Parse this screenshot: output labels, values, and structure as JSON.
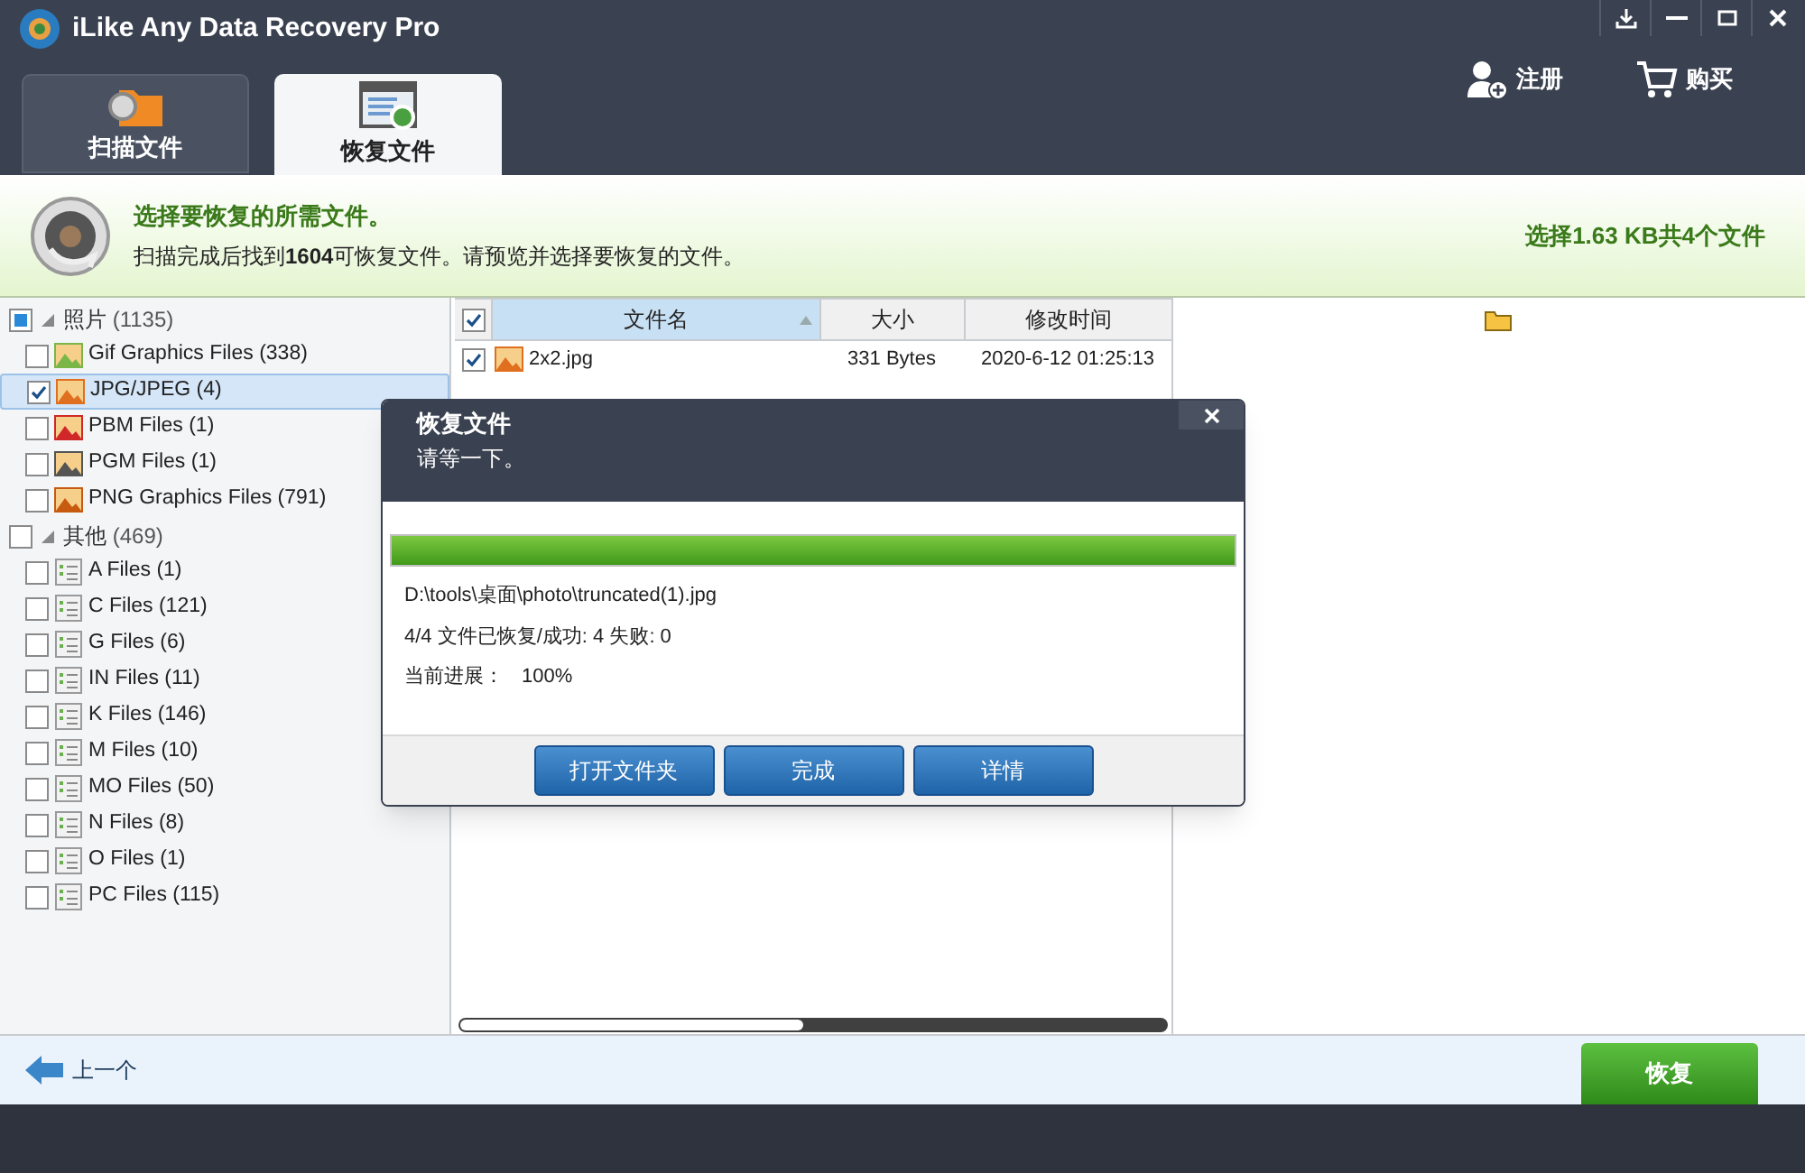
{
  "window": {
    "title": "iLike Any Data Recovery Pro"
  },
  "tabs": [
    {
      "label": "扫描文件",
      "selected": false
    },
    {
      "label": "恢复文件",
      "selected": true
    }
  ],
  "header_links": [
    {
      "kind": "register",
      "label": "注册"
    },
    {
      "kind": "buy",
      "label": "购买"
    }
  ],
  "banner": {
    "title": "选择要恢复的所需文件。",
    "message": "扫描完成后找到**1604**可恢复文件。请预览并选择要恢复的文件。",
    "selection": "选择1.63 KB共4个文件"
  },
  "tree": [
    {
      "label": "照片",
      "count": "(1135)",
      "checked": false,
      "partial": true,
      "expanded": true,
      "children": [
        {
          "label": "Gif Graphics Files (338)",
          "kind": "gif",
          "checked": false,
          "selected": false
        },
        {
          "label": "JPG/JPEG (4)",
          "kind": "jpg",
          "checked": true,
          "selected": true
        },
        {
          "label": "PBM Files (1)",
          "kind": "pbm",
          "checked": false,
          "selected": false
        },
        {
          "label": "PGM Files (1)",
          "kind": "pgm",
          "checked": false,
          "selected": false
        },
        {
          "label": "PNG Graphics Files (791)",
          "kind": "png",
          "checked": false,
          "selected": false
        }
      ]
    },
    {
      "label": "其他",
      "count": "(469)",
      "checked": false,
      "partial": false,
      "expanded": true,
      "children": [
        {
          "label": "A Files (1)",
          "kind": "doc",
          "checked": false,
          "selected": false
        },
        {
          "label": "C Files (121)",
          "kind": "doc",
          "checked": false,
          "selected": false
        },
        {
          "label": "G Files (6)",
          "kind": "doc",
          "checked": false,
          "selected": false
        },
        {
          "label": "IN Files (11)",
          "kind": "doc",
          "checked": false,
          "selected": false
        },
        {
          "label": "K Files (146)",
          "kind": "doc",
          "checked": false,
          "selected": false
        },
        {
          "label": "M Files (10)",
          "kind": "doc",
          "checked": false,
          "selected": false
        },
        {
          "label": "MO Files (50)",
          "kind": "doc",
          "checked": false,
          "selected": false
        },
        {
          "label": "N Files (8)",
          "kind": "doc",
          "checked": false,
          "selected": false
        },
        {
          "label": "O Files (1)",
          "kind": "doc",
          "checked": false,
          "selected": false
        },
        {
          "label": "PC Files (115)",
          "kind": "doc",
          "checked": false,
          "selected": false
        }
      ]
    }
  ],
  "table": {
    "all_checked": true,
    "columns": [
      {
        "label": "文件名",
        "sorted": true
      },
      {
        "label": "大小",
        "sorted": false
      },
      {
        "label": "修改时间",
        "sorted": false
      }
    ],
    "rows": [
      {
        "name": "2x2.jpg",
        "size": "331 Bytes",
        "modified": "2020-6-12 01:25:13",
        "checked": true
      }
    ]
  },
  "dialog": {
    "title": "恢复文件",
    "subtitle": "请等一下。",
    "level": 1,
    "path": "D:\\tools\\桌面\\photo\\truncated(1).jpg",
    "status": "4/4 文件已恢复/成功: 4 失败: 0",
    "progress_label": "当前进展：",
    "progress_value": "100%",
    "buttons": [
      "打开文件夹",
      "完成",
      "详情"
    ]
  },
  "footer": {
    "back": "上一个",
    "recover": "恢复"
  }
}
